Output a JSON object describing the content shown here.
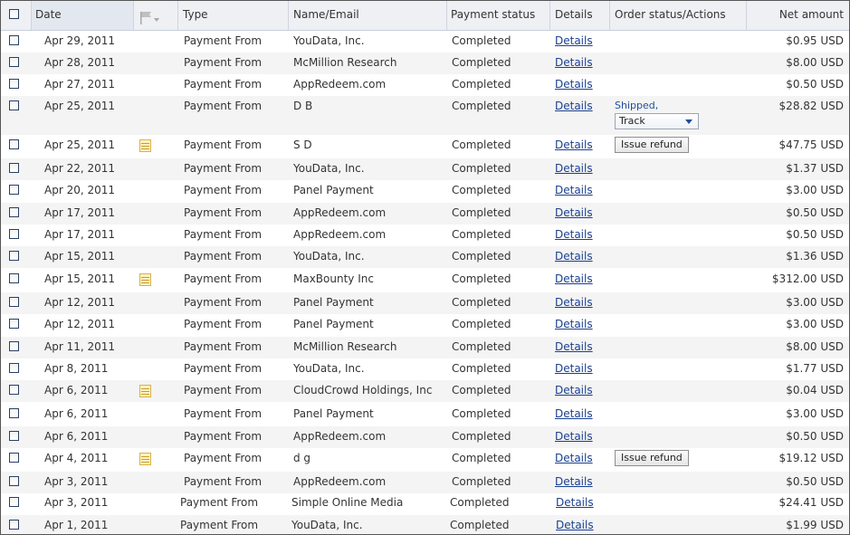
{
  "header": {
    "date": "Date",
    "flag": "flag-icon",
    "type": "Type",
    "name_email": "Name/Email",
    "payment_status": "Payment status",
    "details": "Details",
    "order_status_actions": "Order status/Actions",
    "net_amount": "Net amount"
  },
  "rows": [
    {
      "date": "Apr 29, 2011",
      "note": false,
      "type": "Payment From",
      "name": "YouData, Inc.",
      "status": "Completed",
      "details": "Details",
      "amount": "$0.95 USD"
    },
    {
      "date": "Apr 28, 2011",
      "note": false,
      "type": "Payment From",
      "name": "McMillion Research",
      "status": "Completed",
      "details": "Details",
      "amount": "$8.00 USD"
    },
    {
      "date": "Apr 27, 2011",
      "note": false,
      "type": "Payment From",
      "name": "AppRedeem.com",
      "status": "Completed",
      "details": "Details",
      "amount": "$0.50 USD"
    },
    {
      "date": "Apr 25, 2011",
      "note": false,
      "type": "Payment From",
      "name": "D        B",
      "status": "Completed",
      "details": "Details",
      "amount": "$28.82 USD",
      "shipped": "Shipped,",
      "track": "Track"
    },
    {
      "date": "Apr 25, 2011",
      "note": true,
      "type": "Payment From",
      "name": "S       D",
      "status": "Completed",
      "details": "Details",
      "amount": "$47.75 USD",
      "action": "Issue refund"
    },
    {
      "date": "Apr 22, 2011",
      "note": false,
      "type": "Payment From",
      "name": "YouData, Inc.",
      "status": "Completed",
      "details": "Details",
      "amount": "$1.37 USD"
    },
    {
      "date": "Apr 20, 2011",
      "note": false,
      "type": "Payment From",
      "name": "Panel Payment",
      "status": "Completed",
      "details": "Details",
      "amount": "$3.00 USD"
    },
    {
      "date": "Apr 17, 2011",
      "note": false,
      "type": "Payment From",
      "name": "AppRedeem.com",
      "status": "Completed",
      "details": "Details",
      "amount": "$0.50 USD"
    },
    {
      "date": "Apr 17, 2011",
      "note": false,
      "type": "Payment From",
      "name": "AppRedeem.com",
      "status": "Completed",
      "details": "Details",
      "amount": "$0.50 USD"
    },
    {
      "date": "Apr 15, 2011",
      "note": false,
      "type": "Payment From",
      "name": "YouData, Inc.",
      "status": "Completed",
      "details": "Details",
      "amount": "$1.36 USD"
    },
    {
      "date": "Apr 15, 2011",
      "note": true,
      "type": "Payment From",
      "name": "MaxBounty Inc",
      "status": "Completed",
      "details": "Details",
      "amount": "$312.00 USD"
    },
    {
      "date": "Apr 12, 2011",
      "note": false,
      "type": "Payment From",
      "name": "Panel Payment",
      "status": "Completed",
      "details": "Details",
      "amount": "$3.00 USD"
    },
    {
      "date": "Apr 12, 2011",
      "note": false,
      "type": "Payment From",
      "name": "Panel Payment",
      "status": "Completed",
      "details": "Details",
      "amount": "$3.00 USD"
    },
    {
      "date": "Apr 11, 2011",
      "note": false,
      "type": "Payment From",
      "name": "McMillion Research",
      "status": "Completed",
      "details": "Details",
      "amount": "$8.00 USD"
    },
    {
      "date": "Apr 8, 2011",
      "note": false,
      "type": "Payment From",
      "name": "YouData, Inc.",
      "status": "Completed",
      "details": "Details",
      "amount": "$1.77 USD"
    },
    {
      "date": "Apr 6, 2011",
      "note": true,
      "type": "Payment From",
      "name": "CloudCrowd Holdings, Inc",
      "status": "Completed",
      "details": "Details",
      "amount": "$0.04 USD"
    },
    {
      "date": "Apr 6, 2011",
      "note": false,
      "type": "Payment From",
      "name": "Panel Payment",
      "status": "Completed",
      "details": "Details",
      "amount": "$3.00 USD"
    },
    {
      "date": "Apr 6, 2011",
      "note": false,
      "type": "Payment From",
      "name": "AppRedeem.com",
      "status": "Completed",
      "details": "Details",
      "amount": "$0.50 USD"
    },
    {
      "date": "Apr 4, 2011",
      "note": true,
      "type": "Payment From",
      "name": "d        g",
      "status": "Completed",
      "details": "Details",
      "amount": "$19.12 USD",
      "action": "Issue refund"
    },
    {
      "date": "Apr 3, 2011",
      "note": false,
      "type": "Payment From",
      "name": "AppRedeem.com",
      "status": "Completed",
      "details": "Details",
      "amount": "$0.50 USD"
    },
    {
      "date": "Apr 3, 2011",
      "note": false,
      "type": "Payment From",
      "name": "Simple Online Media",
      "status": "Completed",
      "details": "Details",
      "amount": "$24.41 USD"
    },
    {
      "date": "Apr 1, 2011",
      "note": false,
      "type": "Payment From",
      "name": "YouData, Inc.",
      "status": "Completed",
      "details": "Details",
      "amount": "$1.99 USD"
    }
  ],
  "colors": {
    "link": "#1a3f8f",
    "header_bg": "#eef0f4",
    "row_alt_bg": "#f4f4f4",
    "shipped_text": "#1f4e9c"
  }
}
